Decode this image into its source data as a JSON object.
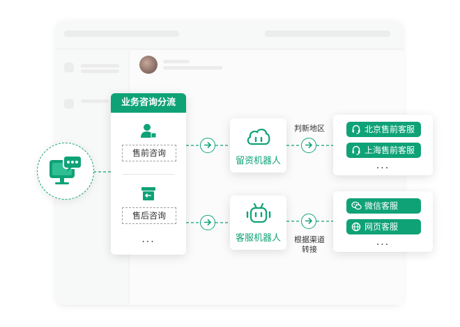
{
  "header": {
    "title": "业务咨询分流"
  },
  "consult_types": [
    {
      "label": "售前咨询",
      "icon": "user-icon"
    },
    {
      "label": "售后咨询",
      "icon": "return-box-icon"
    }
  ],
  "more": "...",
  "bots": [
    {
      "label": "留资机器人",
      "icon": "cloud-bot-icon"
    },
    {
      "label": "客服机器人",
      "icon": "robot-icon"
    }
  ],
  "routes": [
    {
      "label": "判新地区"
    },
    {
      "label_line1": "根据渠道",
      "label_line2": "转接"
    }
  ],
  "agents_top": [
    {
      "label": "北京售前客服",
      "icon": "headset-icon"
    },
    {
      "label": "上海售前客服",
      "icon": "headset-icon"
    }
  ],
  "agents_bottom": [
    {
      "label": "微信客服",
      "icon": "wechat-icon"
    },
    {
      "label": "网页客服",
      "icon": "globe-icon"
    }
  ],
  "colors": {
    "accent": "#0fa277",
    "card": "#ffffff"
  }
}
